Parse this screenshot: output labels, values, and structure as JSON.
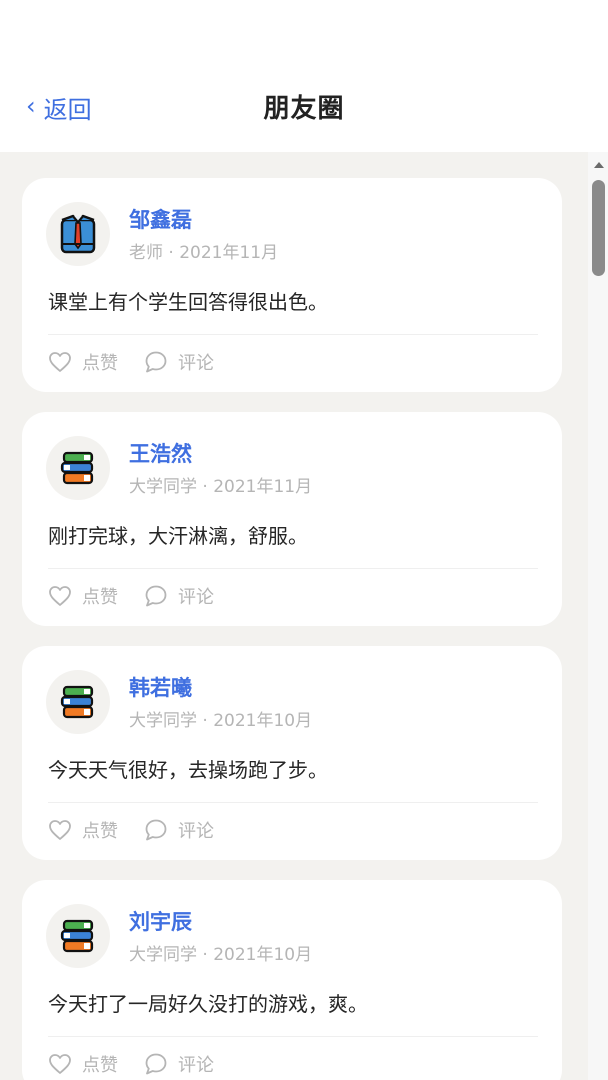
{
  "header": {
    "back_label": "返回",
    "title": "朋友圈"
  },
  "posts": [
    {
      "name": "邹鑫磊",
      "meta": "老师 · 2021年11月",
      "content": "课堂上有个学生回答得很出色。",
      "avatar": "shirt-tie-icon"
    },
    {
      "name": "王浩然",
      "meta": "大学同学 · 2021年11月",
      "content": "刚打完球，大汗淋漓，舒服。",
      "avatar": "books-icon"
    },
    {
      "name": "韩若曦",
      "meta": "大学同学 · 2021年10月",
      "content": "今天天气很好，去操场跑了步。",
      "avatar": "books-icon"
    },
    {
      "name": "刘宇辰",
      "meta": "大学同学 · 2021年10月",
      "content": "今天打了一局好久没打的游戏，爽。",
      "avatar": "books-icon"
    }
  ],
  "actions": {
    "like_label": "点赞",
    "comment_label": "评论"
  },
  "colors": {
    "accent": "#3f6fe0",
    "feed_bg": "#f3f2ef",
    "muted": "#b5b5b5"
  }
}
